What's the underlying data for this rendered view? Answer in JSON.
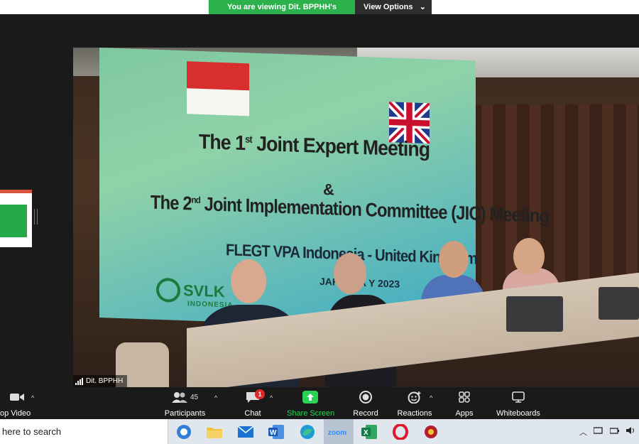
{
  "share_banner": {
    "viewing_text": "You are viewing Dit. BPPHH's screen",
    "view_options_label": "View Options",
    "caret": "⌄"
  },
  "slide": {
    "title_line1_pre": "The 1",
    "title_line1_sup": "st",
    "title_line1_post": " Joint Expert Meeting",
    "ampersand": "&",
    "title_line2_pre": "The 2",
    "title_line2_sup": "nd",
    "title_line2_post": " Joint Implementation Committee (JIC) Meeting",
    "title_line3": "FLEGT VPA Indonesia - United Kingdom",
    "location_line": "JAKARTA        Y 2023",
    "logo_word": "SVLK",
    "logo_sub": "INDONESIA"
  },
  "participant_tag": {
    "name": "Dit. BPPHH"
  },
  "toolbar": {
    "video_label": "op Video",
    "participants_label": "Participants",
    "participants_count": "45",
    "chat_label": "Chat",
    "chat_badge": "1",
    "share_label": "Share Screen",
    "record_label": "Record",
    "reactions_label": "Reactions",
    "apps_label": "Apps",
    "whiteboards_label": "Whiteboards",
    "caret_up": "^"
  },
  "taskbar": {
    "search_placeholder": "here to search",
    "apps": [
      "edge-legacy-icon",
      "file-explorer-icon",
      "mail-icon",
      "word-icon",
      "edge-icon",
      "zoom-icon",
      "excel-icon",
      "opera-icon",
      "app-icon"
    ],
    "zoom_label": "zoom"
  },
  "colors": {
    "accent_green": "#2bb24c",
    "badge_red": "#e02828",
    "share_green": "#2bd154"
  }
}
